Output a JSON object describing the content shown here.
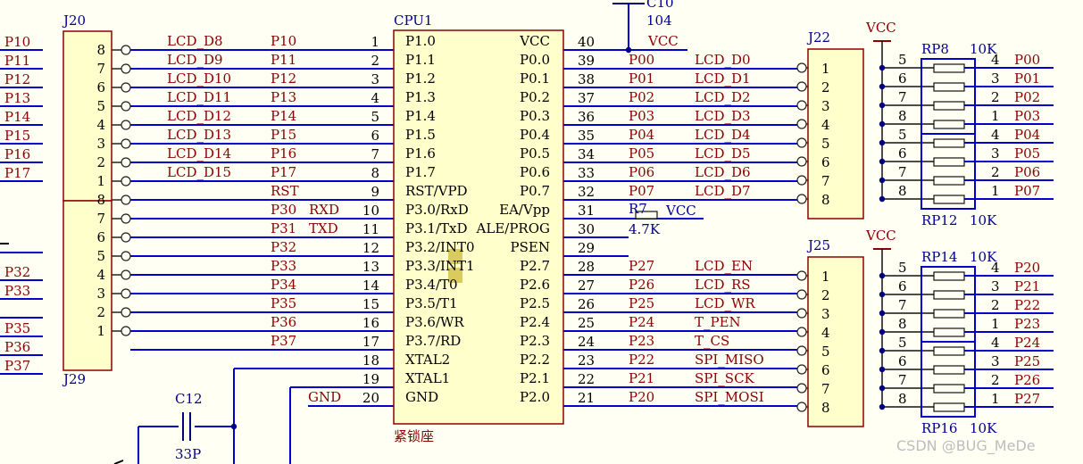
{
  "cpu": {
    "ref": "CPU1",
    "socket_label": "紧锁座",
    "left_pins": [
      {
        "num": "1",
        "name": "P1.0",
        "net": "P10"
      },
      {
        "num": "2",
        "name": "P1.1",
        "net": "P11"
      },
      {
        "num": "3",
        "name": "P1.2",
        "net": "P12"
      },
      {
        "num": "4",
        "name": "P1.3",
        "net": "P13"
      },
      {
        "num": "5",
        "name": "P1.4",
        "net": "P14"
      },
      {
        "num": "6",
        "name": "P1.5",
        "net": "P15"
      },
      {
        "num": "7",
        "name": "P1.6",
        "net": "P16"
      },
      {
        "num": "8",
        "name": "P1.7",
        "net": "P17"
      },
      {
        "num": "9",
        "name": "RST/VPD",
        "net": "RST"
      },
      {
        "num": "10",
        "name": "P3.0/RxD",
        "net": "P30",
        "extra": "RXD"
      },
      {
        "num": "11",
        "name": "P3.1/TxD",
        "net": "P31",
        "extra": "TXD"
      },
      {
        "num": "12",
        "name": "P3.2/INT0",
        "net": "P32"
      },
      {
        "num": "13",
        "name": "P3.3/INT1",
        "net": "P33"
      },
      {
        "num": "14",
        "name": "P3.4/T0",
        "net": "P34"
      },
      {
        "num": "15",
        "name": "P3.5/T1",
        "net": "P35"
      },
      {
        "num": "16",
        "name": "P3.6/WR",
        "net": "P36"
      },
      {
        "num": "17",
        "name": "P3.7/RD",
        "net": "P37"
      },
      {
        "num": "18",
        "name": "XTAL2",
        "net": ""
      },
      {
        "num": "19",
        "name": "XTAL1",
        "net": ""
      },
      {
        "num": "20",
        "name": "GND",
        "net": "GND"
      }
    ],
    "right_pins": [
      {
        "num": "40",
        "name": "VCC",
        "net": "VCC",
        "lcd": ""
      },
      {
        "num": "39",
        "name": "P0.0",
        "net": "P00",
        "lcd": "LCD_D0"
      },
      {
        "num": "38",
        "name": "P0.1",
        "net": "P01",
        "lcd": "LCD_D1"
      },
      {
        "num": "37",
        "name": "P0.2",
        "net": "P02",
        "lcd": "LCD_D2"
      },
      {
        "num": "36",
        "name": "P0.3",
        "net": "P03",
        "lcd": "LCD_D3"
      },
      {
        "num": "35",
        "name": "P0.4",
        "net": "P04",
        "lcd": "LCD_D4"
      },
      {
        "num": "34",
        "name": "P0.5",
        "net": "P05",
        "lcd": "LCD_D5"
      },
      {
        "num": "33",
        "name": "P0.6",
        "net": "P06",
        "lcd": "LCD_D6"
      },
      {
        "num": "32",
        "name": "P0.7",
        "net": "P07",
        "lcd": "LCD_D7"
      },
      {
        "num": "31",
        "name": "EA/Vpp",
        "net": "",
        "lcd": ""
      },
      {
        "num": "30",
        "name": "ALE/PROG",
        "net": "",
        "lcd": ""
      },
      {
        "num": "29",
        "name": "PSEN",
        "net": "",
        "lcd": ""
      },
      {
        "num": "28",
        "name": "P2.7",
        "net": "P27",
        "lcd": "LCD_EN"
      },
      {
        "num": "27",
        "name": "P2.6",
        "net": "P26",
        "lcd": "LCD_RS"
      },
      {
        "num": "26",
        "name": "P2.5",
        "net": "P25",
        "lcd": "LCD_WR"
      },
      {
        "num": "25",
        "name": "P2.4",
        "net": "P24",
        "lcd": "T_PEN"
      },
      {
        "num": "24",
        "name": "P2.3",
        "net": "P23",
        "lcd": "T_CS"
      },
      {
        "num": "23",
        "name": "P2.2",
        "net": "P22",
        "lcd": "SPI_MISO"
      },
      {
        "num": "22",
        "name": "P2.1",
        "net": "P21",
        "lcd": "SPI_SCK"
      },
      {
        "num": "21",
        "name": "P2.0",
        "net": "P20",
        "lcd": "SPI_MOSI"
      }
    ]
  },
  "j20": {
    "ref": "J20",
    "pins": [
      "8",
      "7",
      "6",
      "5",
      "4",
      "3",
      "2",
      "1"
    ],
    "lcd": [
      "LCD_D8",
      "LCD_D9",
      "LCD_D10",
      "LCD_D11",
      "LCD_D12",
      "LCD_D13",
      "LCD_D14",
      "LCD_D15"
    ],
    "ext_nets": [
      "P10",
      "P11",
      "P12",
      "P13",
      "P14",
      "P15",
      "P16",
      "P17"
    ]
  },
  "j29": {
    "ref": "J29",
    "pins": [
      "8",
      "7",
      "6",
      "5",
      "4",
      "3",
      "2",
      "1"
    ],
    "ext_nets": [
      "",
      "",
      "",
      "P32",
      "P33",
      "",
      "P35",
      "P36",
      "P37"
    ]
  },
  "j22": {
    "ref": "J22",
    "pins": [
      "1",
      "2",
      "3",
      "4",
      "5",
      "6",
      "7",
      "8"
    ]
  },
  "j25": {
    "ref": "J25",
    "pins": [
      "1",
      "2",
      "3",
      "4",
      "5",
      "6",
      "7",
      "8"
    ]
  },
  "rp_top": {
    "vcc": "VCC",
    "rp_a": "RP8",
    "rp_b": "RP12",
    "val": "10K",
    "left_nums": [
      "5",
      "6",
      "7",
      "8",
      "5",
      "6",
      "7",
      "8"
    ],
    "right_nums": [
      "4",
      "3",
      "2",
      "1",
      "4",
      "3",
      "2",
      "1"
    ],
    "nets": [
      "P00",
      "P01",
      "P02",
      "P03",
      "P04",
      "P05",
      "P06",
      "P07"
    ]
  },
  "rp_bot": {
    "vcc": "VCC",
    "rp_a": "RP14",
    "rp_b": "RP16",
    "val": "10K",
    "left_nums": [
      "5",
      "6",
      "7",
      "8",
      "5",
      "6",
      "7",
      "8"
    ],
    "right_nums": [
      "4",
      "3",
      "2",
      "1",
      "4",
      "3",
      "2",
      "1"
    ],
    "nets": [
      "P20",
      "P21",
      "P22",
      "P23",
      "P24",
      "P25",
      "P26",
      "P27"
    ]
  },
  "c10": {
    "ref": "C10",
    "val": "104",
    "net": "VCC"
  },
  "r7": {
    "ref": "R7",
    "val": "4.7K",
    "net": "VCC"
  },
  "c12": {
    "ref": "C12",
    "val": "33P"
  },
  "watermark": "CSDN @BUG_MeDe",
  "colors": {
    "wire": "#0000cc",
    "body": "#ffffcc",
    "body_border": "#8b0000",
    "label": "#8b0000",
    "highlight": "#d4c24a"
  }
}
